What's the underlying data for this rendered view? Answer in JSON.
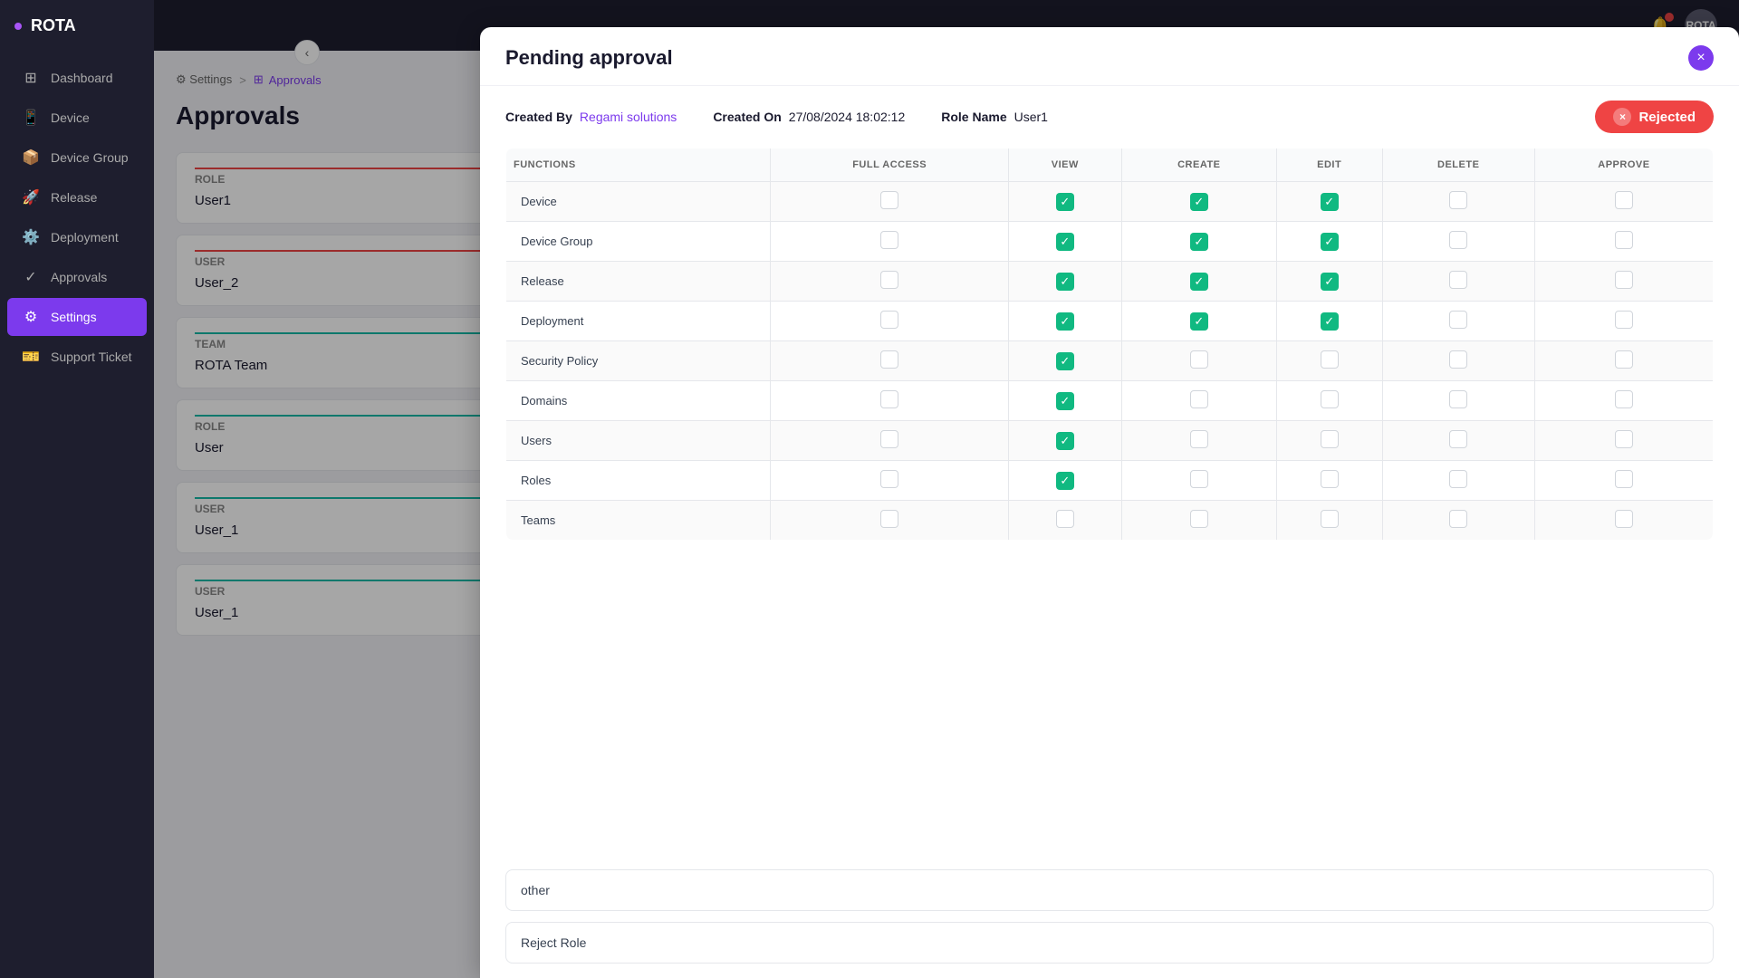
{
  "app": {
    "name": "ROTA",
    "avatar_text": "ROTA"
  },
  "sidebar": {
    "items": [
      {
        "id": "dashboard",
        "label": "Dashboard",
        "icon": "⊞",
        "active": false
      },
      {
        "id": "device",
        "label": "Device",
        "icon": "📱",
        "active": false
      },
      {
        "id": "device-group",
        "label": "Device Group",
        "icon": "📦",
        "active": false
      },
      {
        "id": "release",
        "label": "Release",
        "icon": "🚀",
        "active": false
      },
      {
        "id": "deployment",
        "label": "Deployment",
        "icon": "⚙️",
        "active": false
      },
      {
        "id": "approvals",
        "label": "Approvals",
        "icon": "✓",
        "active": false
      },
      {
        "id": "settings",
        "label": "Settings",
        "icon": "⚙",
        "active": true
      },
      {
        "id": "support-ticket",
        "label": "Support Ticket",
        "icon": "🎫",
        "active": false
      }
    ]
  },
  "breadcrumb": {
    "items": [
      "Settings",
      "Approvals"
    ],
    "separator": ">"
  },
  "page": {
    "title": "Approvals"
  },
  "approval_cards": [
    {
      "section": "Role",
      "section_color": "red",
      "value": "User1"
    },
    {
      "section": "User",
      "section_color": "red",
      "value": "User_2"
    },
    {
      "section": "Team",
      "section_color": "teal",
      "value": "ROTA Team"
    },
    {
      "section": "Role",
      "section_color": "teal",
      "value": "User"
    },
    {
      "section": "User",
      "section_color": "teal",
      "value": "User_1"
    },
    {
      "section": "User",
      "section_color": "teal",
      "value": "User_1"
    }
  ],
  "modal": {
    "title": "Pending approval",
    "close_icon": "×",
    "meta": {
      "created_by_label": "Created By",
      "created_by_value": "Regami solutions",
      "created_on_label": "Created On",
      "created_on_value": "27/08/2024 18:02:12",
      "role_name_label": "Role Name",
      "role_name_value": "User1"
    },
    "status": {
      "label": "Rejected",
      "icon": "×"
    },
    "table": {
      "headers": [
        "FUNCTIONS",
        "FULL ACCESS",
        "VIEW",
        "CREATE",
        "EDIT",
        "DELETE",
        "APPROVE"
      ],
      "rows": [
        {
          "function": "Device",
          "full_access": false,
          "view": true,
          "create": true,
          "edit": true,
          "delete": false,
          "approve": false
        },
        {
          "function": "Device Group",
          "full_access": false,
          "view": true,
          "create": true,
          "edit": true,
          "delete": false,
          "approve": false
        },
        {
          "function": "Release",
          "full_access": false,
          "view": true,
          "create": true,
          "edit": true,
          "delete": false,
          "approve": false
        },
        {
          "function": "Deployment",
          "full_access": false,
          "view": true,
          "create": true,
          "edit": true,
          "delete": false,
          "approve": false
        },
        {
          "function": "Security Policy",
          "full_access": false,
          "view": true,
          "create": false,
          "edit": false,
          "delete": false,
          "approve": false
        },
        {
          "function": "Domains",
          "full_access": false,
          "view": true,
          "create": false,
          "edit": false,
          "delete": false,
          "approve": false
        },
        {
          "function": "Users",
          "full_access": false,
          "view": true,
          "create": false,
          "edit": false,
          "delete": false,
          "approve": false
        },
        {
          "function": "Roles",
          "full_access": false,
          "view": true,
          "create": false,
          "edit": false,
          "delete": false,
          "approve": false
        },
        {
          "function": "Teams",
          "full_access": false,
          "view": false,
          "create": false,
          "edit": false,
          "delete": false,
          "approve": false
        }
      ]
    },
    "other_label": "other",
    "reject_role_label": "Reject Role"
  }
}
